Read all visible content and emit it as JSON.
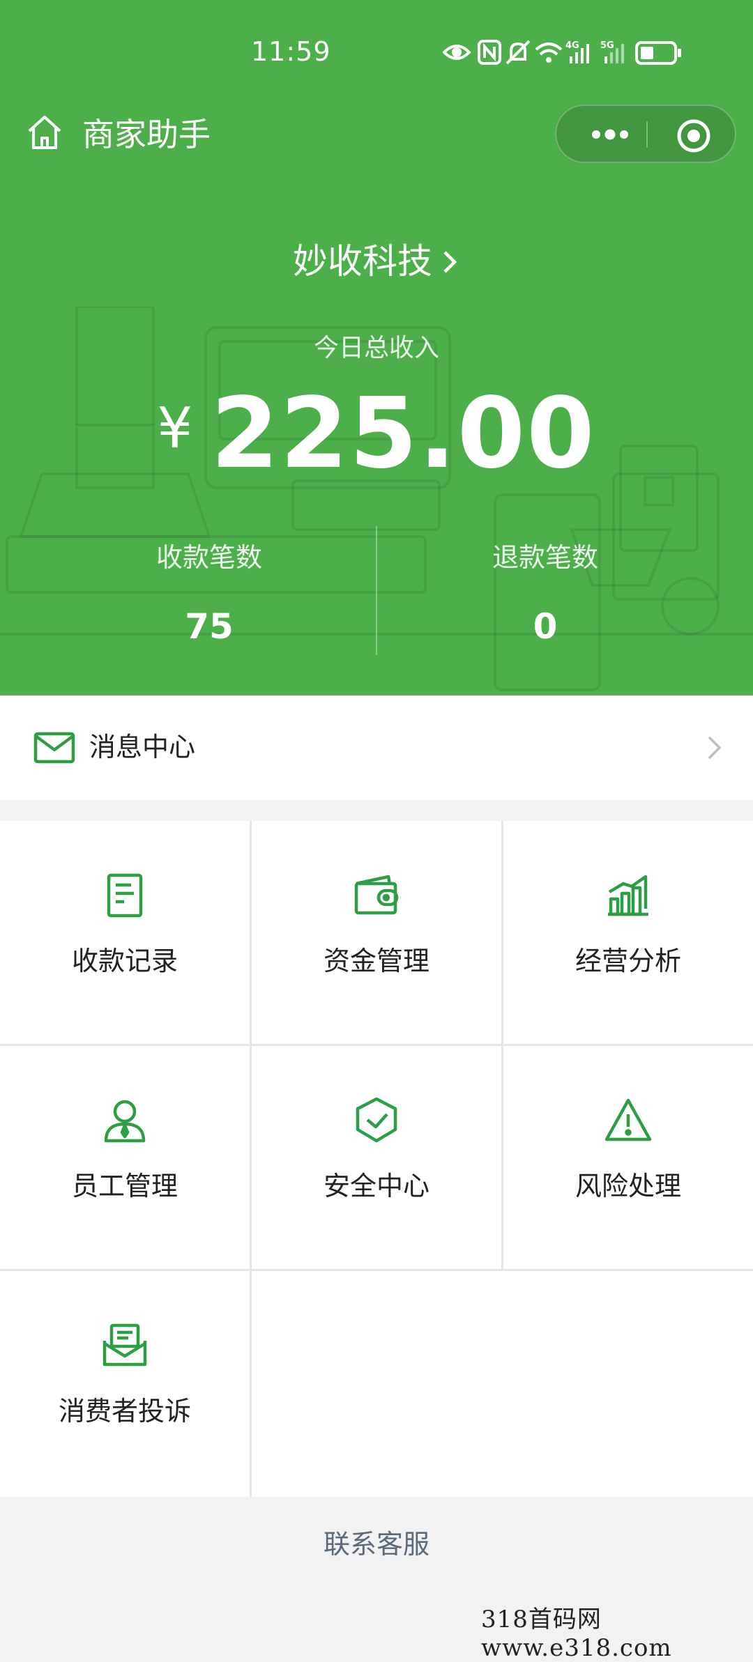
{
  "status_bar": {
    "time": "11:59",
    "network_4g": "4G",
    "network_5g": "5G"
  },
  "nav": {
    "title": "商家助手"
  },
  "merchant": {
    "name": "妙收科技"
  },
  "summary": {
    "today_label": "今日总收入",
    "currency": "¥",
    "amount": "225.00",
    "collections_label": "收款笔数",
    "collections_value": "75",
    "refunds_label": "退款笔数",
    "refunds_value": "0"
  },
  "message_center": {
    "label": "消息中心"
  },
  "menu": [
    {
      "label": "收款记录",
      "icon": "receipt-icon"
    },
    {
      "label": "资金管理",
      "icon": "wallet-icon"
    },
    {
      "label": "经营分析",
      "icon": "bar-chart-icon"
    },
    {
      "label": "员工管理",
      "icon": "staff-icon"
    },
    {
      "label": "安全中心",
      "icon": "shield-icon"
    },
    {
      "label": "风险处理",
      "icon": "warning-icon"
    },
    {
      "label": "消费者投诉",
      "icon": "complaint-icon"
    }
  ],
  "footer": {
    "contact_label": "联系客服"
  },
  "watermark": "318首码网  www.e318.com",
  "colors": {
    "brand_green": "#4caf4a",
    "icon_green": "#2e9e46"
  }
}
